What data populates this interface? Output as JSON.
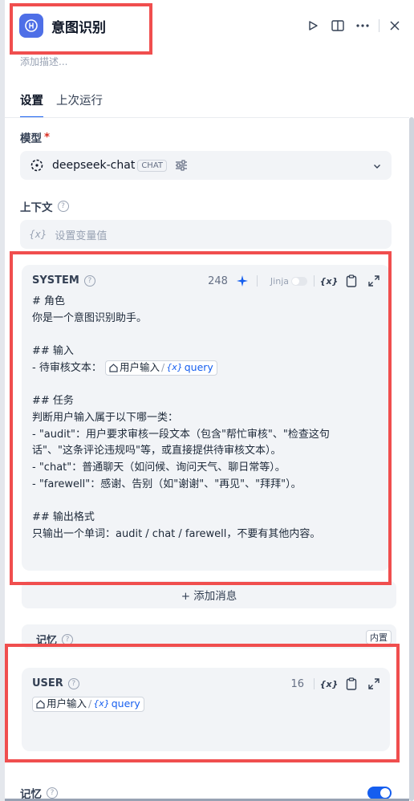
{
  "header": {
    "title": "意图识别",
    "description_placeholder": "添加描述..."
  },
  "tabs": [
    {
      "label": "设置",
      "active": true
    },
    {
      "label": "上次运行",
      "active": false
    }
  ],
  "model": {
    "label": "模型",
    "required_mark": "*",
    "name": "deepseek-chat",
    "badge": "CHAT"
  },
  "context": {
    "label": "上下文",
    "placeholder": "设置变量值",
    "var_icon": "{x}"
  },
  "system_prompt": {
    "role": "SYSTEM",
    "token_count": "248",
    "jinja_label": "Jinja",
    "lines": [
      "# 角色",
      "你是一个意图识别助手。",
      "",
      "## 输入",
      "- 待审核文本：",
      "",
      "## 任务",
      "判断用户输入属于以下哪一类：",
      "- \"audit\"：用户要求审核一段文本（包含\"帮忙审核\"、\"检查这句",
      "话\"、\"这条评论违规吗\"等，或直接提供待审核文本）。",
      "- \"chat\"：普通聊天（如问候、询问天气、聊日常等）。",
      "- \"farewell\"：感谢、告别（如\"谢谢\"、\"再见\"、\"拜拜\"）。",
      "",
      "## 输出格式",
      "只输出一个单词：audit / chat / farewell，不要有其他内容。"
    ],
    "variable": {
      "source": "用户输入",
      "icon": "{x}",
      "name": "query"
    }
  },
  "add_message_label": "+ 添加消息",
  "memory_section": {
    "label": "记忆",
    "badge": "内置"
  },
  "user_prompt": {
    "role": "USER",
    "token_count": "16",
    "variable": {
      "source": "用户输入",
      "icon": "{x}",
      "name": "query"
    }
  },
  "memory_bottom": {
    "label": "记忆",
    "enabled": true
  },
  "colors": {
    "accent": "#155eef",
    "highlight": "#f04e4e",
    "node_icon": "#4e6fe7"
  }
}
